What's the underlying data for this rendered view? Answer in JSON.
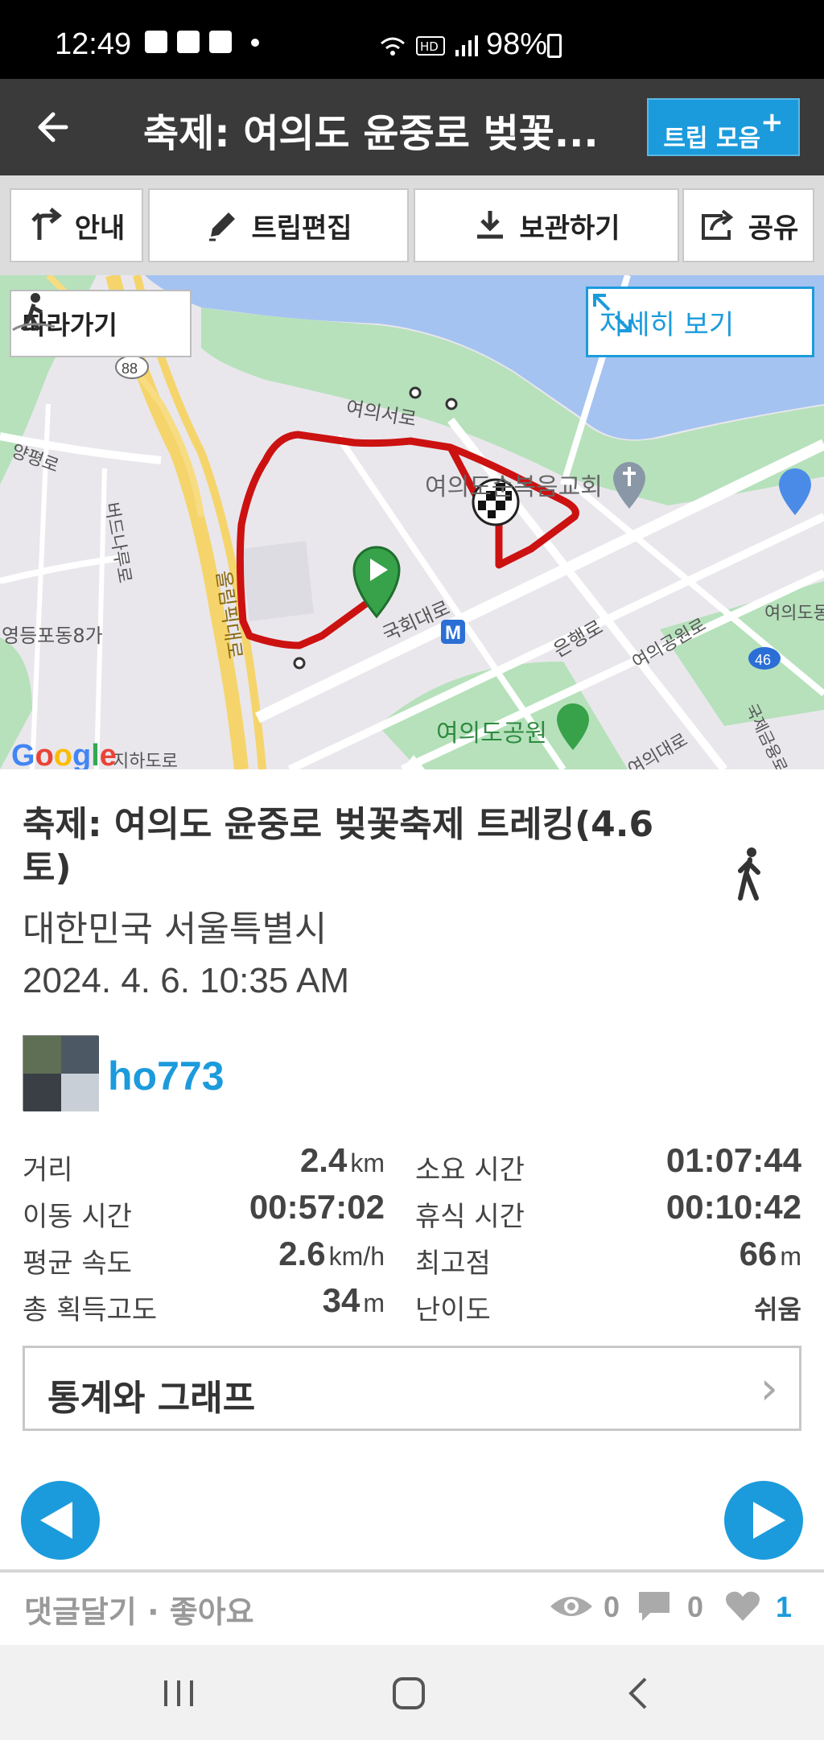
{
  "status_bar": {
    "time": "12:49",
    "battery": "98%"
  },
  "app_bar": {
    "title": "축제: 여의도 윤중로 벚꽃...",
    "collect_button": "트립 모음",
    "collect_plus": "+"
  },
  "toolbar": {
    "guide": "안내",
    "edit": "트립편집",
    "save": "보관하기",
    "share": "공유"
  },
  "map": {
    "follow_button": "따라가기",
    "detail_button": "자세히 보기",
    "labels": {
      "yeouiseoro": "여의서로",
      "church": "여의도순복음교회",
      "gukhoedaero": "국회대로",
      "eunhaengro": "은행로",
      "park_road": "여의공원로",
      "yeouido_park": "여의도공원",
      "olympic": "올림픽대로",
      "yeongdeungpo": "영등포동8가",
      "yeouidaero": "여의대로",
      "gukjegeumyung": "국제금융로",
      "underpass": "지하도로",
      "yeouido_dong": "여의도동",
      "badununaru": "버드나루로",
      "yanpyeong": "양평로",
      "route88": "88",
      "route46": "46",
      "metro": "M"
    },
    "google": "Google"
  },
  "trip": {
    "title": "축제: 여의도 윤중로 벚꽃축제 트레킹(4.6 토)",
    "location": "대한민국 서울특별시",
    "datetime": "2024. 4. 6. 10:35 AM",
    "username": "ho773"
  },
  "stats": {
    "distance_label": "거리",
    "distance_value": "2.4",
    "distance_unit": "km",
    "duration_label": "소요 시간",
    "duration_value": "01:07:44",
    "moving_label": "이동 시간",
    "moving_value": "00:57:02",
    "rest_label": "휴식 시간",
    "rest_value": "00:10:42",
    "speed_label": "평균 속도",
    "speed_value": "2.6",
    "speed_unit": "km/h",
    "max_alt_label": "최고점",
    "max_alt_value": "66",
    "max_alt_unit": "m",
    "gain_label": "총 획득고도",
    "gain_value": "34",
    "gain_unit": "m",
    "difficulty_label": "난이도",
    "difficulty_value": "쉬움"
  },
  "graph_button": {
    "label": "통계와 그래프",
    "chevron": "›"
  },
  "footer": {
    "comment_like": "댓글달기 · 좋아요",
    "views": "0",
    "comments": "0",
    "likes": "1"
  },
  "colors": {
    "accent": "#1c9bdc",
    "route": "#cc1111",
    "appbar": "#3a3a3a"
  }
}
